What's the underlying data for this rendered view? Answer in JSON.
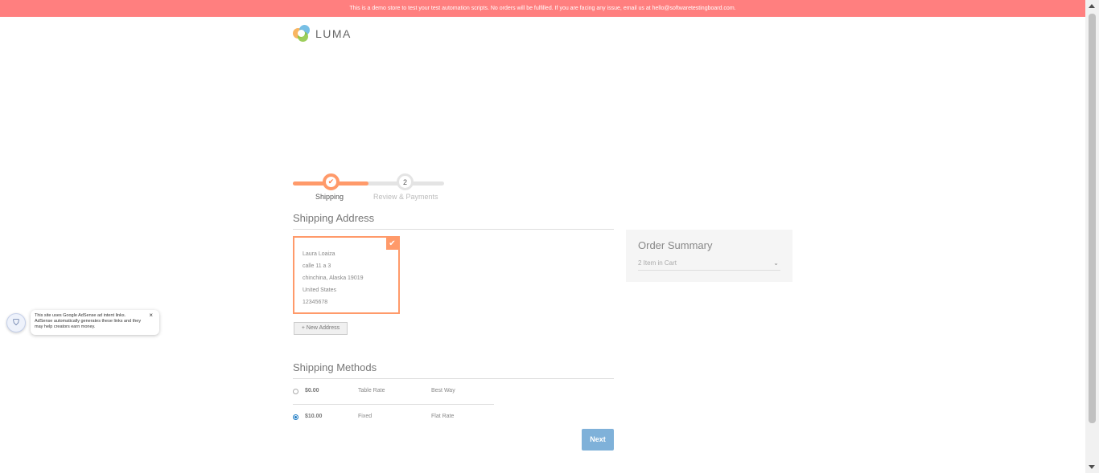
{
  "banner": {
    "text": "This is a demo store to test your test automation scripts. No orders will be fulfilled. If you are facing any issue, email us at hello@softwaretestingboard.com."
  },
  "logo": {
    "text": "LUMA"
  },
  "progress": {
    "steps": [
      {
        "label": "Shipping",
        "state": "complete",
        "icon": "check-icon"
      },
      {
        "label": "Review & Payments",
        "number": "2",
        "state": "pending"
      }
    ],
    "completion": 0.5
  },
  "shipping_address": {
    "title": "Shipping Address",
    "card": {
      "name": "Laura Loaiza",
      "street": "calle 11 a 3",
      "city_line": "chinchina, Alaska 19019",
      "country": "United States",
      "phone": "12345678",
      "selected": true
    },
    "new_address_label": "+ New Address"
  },
  "order_summary": {
    "title": "Order Summary",
    "items_label": "2 Item in Cart"
  },
  "shipping_methods": {
    "title": "Shipping Methods",
    "options": [
      {
        "price": "$0.00",
        "method": "Table Rate",
        "carrier": "Best Way",
        "selected": false
      },
      {
        "price": "$10.00",
        "method": "Fixed",
        "carrier": "Flat Rate",
        "selected": true
      }
    ]
  },
  "next_button": {
    "label": "Next"
  },
  "ad_notice": {
    "text": "This site uses Google AdSense ad intent links. AdSense automatically generates these links and they may help creators earn money.",
    "close": "×"
  },
  "colors": {
    "banner": "#ff7f7f",
    "accent": "#ff9a6a",
    "primary_button": "#7fb1d9"
  }
}
